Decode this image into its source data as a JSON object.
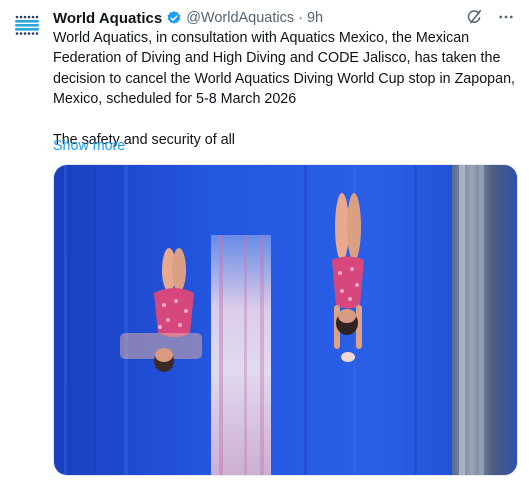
{
  "account": {
    "display_name": "World Aquatics",
    "handle": "@WorldAquatics",
    "separator": "·",
    "timestamp": "9h",
    "verified_badge_icon": "verified-badge-icon",
    "avatar_icon": "world-aquatics-logo"
  },
  "tweet": {
    "text": "World Aquatics, in consultation with Aquatics Mexico, the Mexican Federation of Diving and High Diving and CODE Jalisco, has taken the decision to cancel the World Aquatics Diving World Cup stop in Zapopan, Mexico, scheduled for 5-8 March 2026\n\nThe safety and security of all",
    "show_more_label": "Show more"
  },
  "actions": {
    "grok_icon": "grok-icon",
    "more_icon": "more-icon"
  },
  "media": {
    "description_icon": "diving-photo"
  },
  "colors": {
    "link": "#1d9bf0",
    "secondary_text": "#536471",
    "verified": "#1d9bf0",
    "pool_blue": "#1f4fd8"
  }
}
